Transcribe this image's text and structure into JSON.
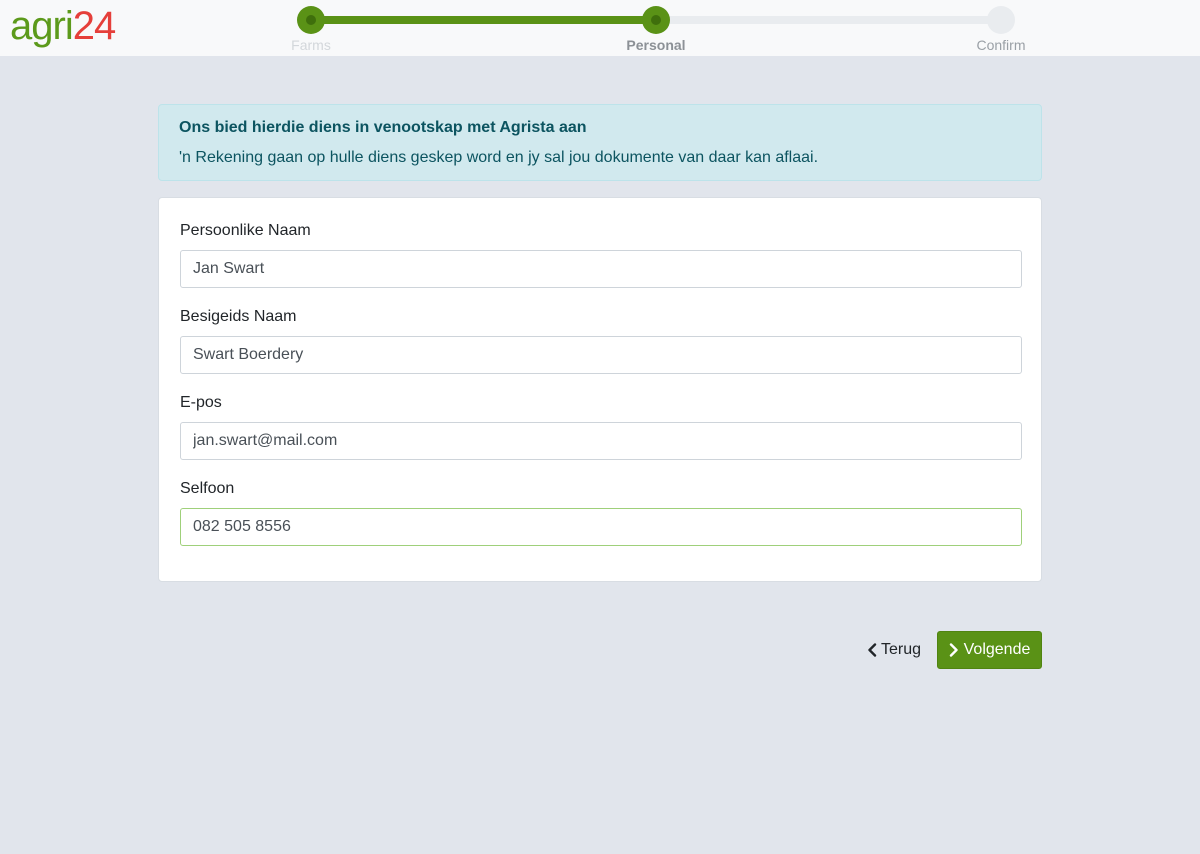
{
  "logo": {
    "part1": "agri",
    "part2": "24"
  },
  "stepper": {
    "steps": [
      {
        "label": "Farms",
        "state": "done"
      },
      {
        "label": "Personal",
        "state": "active"
      },
      {
        "label": "Confirm",
        "state": "todo"
      }
    ],
    "progress_fraction": 0.5
  },
  "alert": {
    "title": "Ons bied hierdie diens in venootskap met Agrista aan",
    "body": "'n Rekening gaan op hulle diens geskep word en jy sal jou dokumente van daar kan aflaai."
  },
  "form": {
    "fields": [
      {
        "label": "Persoonlike Naam",
        "value": "Jan Swart"
      },
      {
        "label": "Besigeids Naam",
        "value": "Swart Boerdery"
      },
      {
        "label": "E-pos",
        "value": "jan.swart@mail.com"
      },
      {
        "label": "Selfoon",
        "value": "082 505 8556"
      }
    ]
  },
  "actions": {
    "back_label": "Terug",
    "next_label": "Volgende"
  },
  "colors": {
    "brand_green": "#5a9216",
    "logo_red": "#e53f3a",
    "alert_text": "#0c5460"
  }
}
